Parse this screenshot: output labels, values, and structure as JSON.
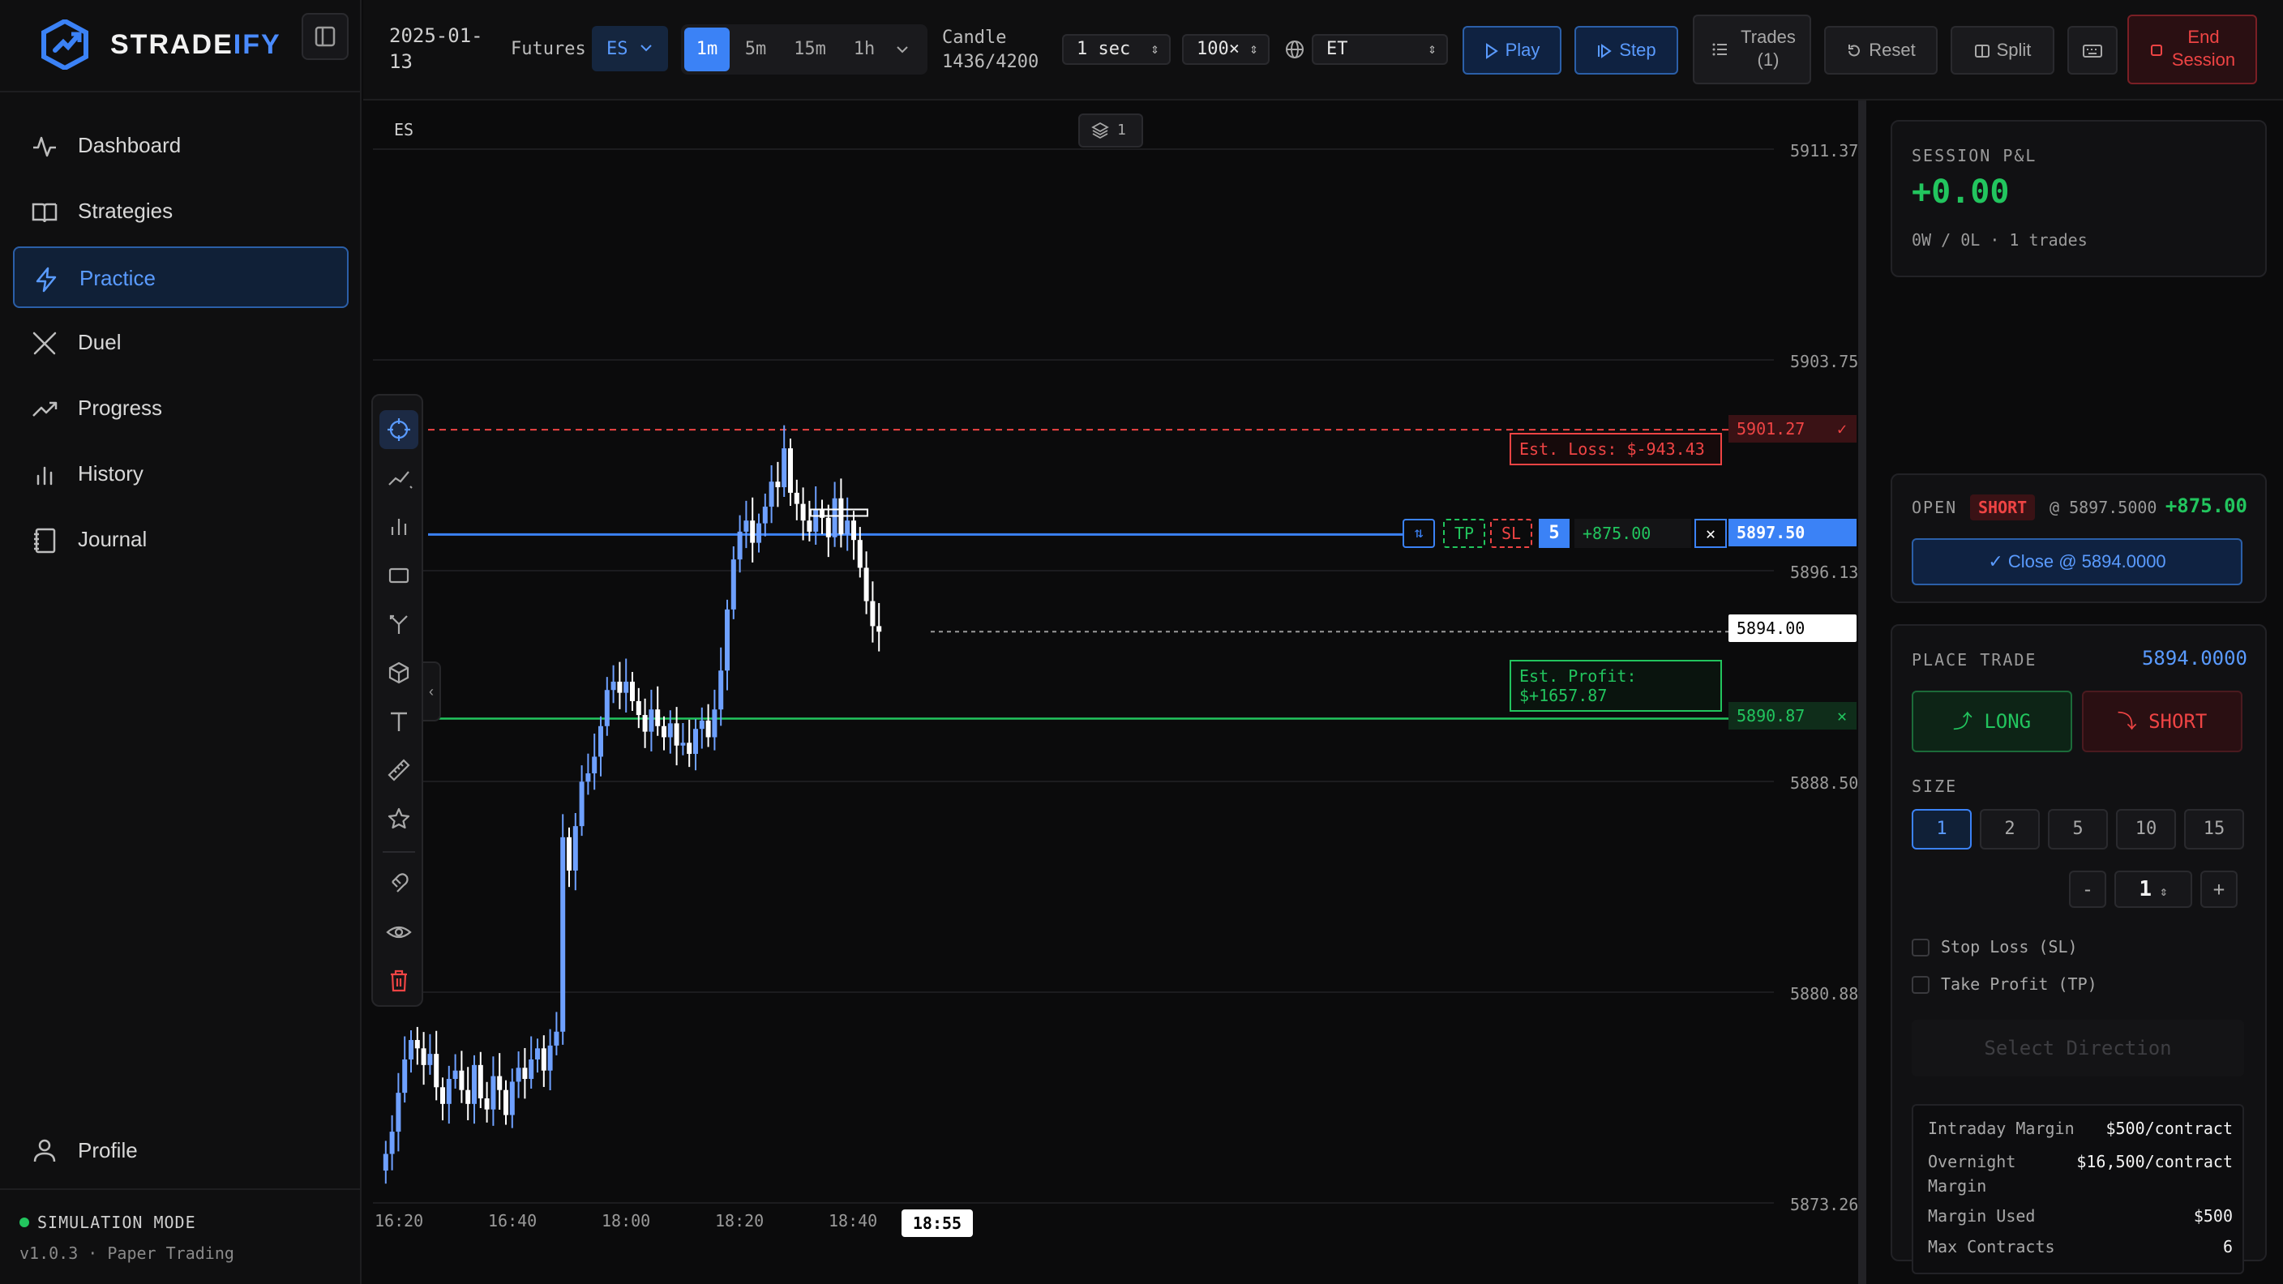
{
  "app": {
    "brand_prefix": "STRADE",
    "brand_suffix": "IFY",
    "accent": "#3b82f6"
  },
  "sidebar": {
    "items": [
      {
        "label": "Dashboard",
        "icon": "activity-icon"
      },
      {
        "label": "Strategies",
        "icon": "book-icon"
      },
      {
        "label": "Practice",
        "icon": "lightning-icon",
        "active": true
      },
      {
        "label": "Duel",
        "icon": "swords-icon"
      },
      {
        "label": "Progress",
        "icon": "trending-up-icon"
      },
      {
        "label": "History",
        "icon": "bar-chart-icon"
      },
      {
        "label": "Journal",
        "icon": "journal-icon"
      }
    ],
    "profile_label": "Profile",
    "sim_mode": "SIMULATION MODE",
    "version": "v1.0.3 · Paper Trading"
  },
  "topbar": {
    "date_line1": "2025-01-",
    "date_line2": "13",
    "market_label": "Futures",
    "symbol": "ES",
    "timeframes": [
      "1m",
      "5m",
      "15m",
      "1h"
    ],
    "active_timeframe": "1m",
    "candle_label": "Candle",
    "candle_progress": "1436/4200",
    "speed": "1 sec",
    "multiplier": "100×",
    "timezone": "ET",
    "play_label": "Play",
    "step_label": "Step",
    "trades_label": "Trades",
    "trades_count": "(1)",
    "reset_label": "Reset",
    "split_label": "Split",
    "end_label_1": "End",
    "end_label_2": "Session"
  },
  "chart": {
    "symbol_label": "ES",
    "layers_count": "1",
    "price_axis": [
      "5911.37",
      "5903.75",
      "5896.13",
      "5888.50",
      "5880.88",
      "5873.26"
    ],
    "time_axis": [
      "16:20",
      "16:40",
      "18:00",
      "18:20",
      "18:40"
    ],
    "current_time": "18:55",
    "stop_loss_price": "5901.27",
    "entry_price": "5897.50",
    "current_price": "5894.00",
    "take_profit_price": "5890.87",
    "est_loss": "Est. Loss: $-943.43",
    "est_profit_line1": "Est. Profit:",
    "est_profit_line2": "$+1657.87",
    "position_qty": "5",
    "position_pnl": "+875.00",
    "tp_label": "TP",
    "sl_label": "SL",
    "colors": {
      "up": "#6ea0ff",
      "down": "#ffffff",
      "loss": "#ef4444",
      "profit": "#22c55e",
      "entry": "#3b82f6"
    }
  },
  "chart_data": {
    "type": "candlestick",
    "y_range": [
      5873.26,
      5911.37
    ],
    "x_labels": [
      "16:20",
      "16:40",
      "18:00",
      "18:20",
      "18:40",
      "18:55"
    ],
    "levels": {
      "stop_loss": 5901.27,
      "entry": 5897.5,
      "current": 5894.0,
      "take_profit": 5890.87
    }
  },
  "panel": {
    "session_pnl_label": "SESSION P&L",
    "session_pnl": "+0.00",
    "session_stats": "0W / 0L · 1 trades",
    "open_label": "OPEN",
    "open_side": "SHORT",
    "open_entry": "@ 5897.5000",
    "open_pnl": "+875.00",
    "close_label": "Close @ 5894.0000",
    "place_trade_label": "PLACE TRADE",
    "place_price": "5894.0000",
    "long_label": "LONG",
    "short_label": "SHORT",
    "size_label": "SIZE",
    "sizes": [
      "1",
      "2",
      "5",
      "10",
      "15"
    ],
    "size_value": "1",
    "minus": "-",
    "plus": "+",
    "stop_loss_option": "Stop Loss (SL)",
    "take_profit_option": "Take Profit (TP)",
    "select_direction": "Select Direction",
    "margin": [
      {
        "k": "Intraday Margin",
        "v": "$500/contract"
      },
      {
        "k": "Overnight Margin",
        "v": "$16,500/contract"
      },
      {
        "k": "Margin Used",
        "v": "$500"
      },
      {
        "k": "Max Contracts",
        "v": "6"
      }
    ]
  }
}
